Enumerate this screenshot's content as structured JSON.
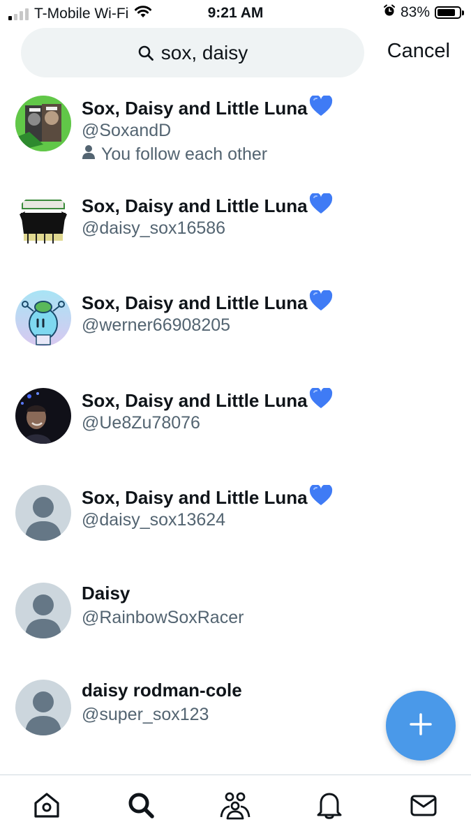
{
  "status_bar": {
    "carrier": "T-Mobile Wi-Fi",
    "time": "9:21 AM",
    "battery_percent": "83%",
    "battery_level": 0.83,
    "signal_bars_active": 1,
    "signal_bars_total": 4,
    "icons": [
      "signal-icon",
      "wifi-icon",
      "alarm-icon",
      "battery-icon"
    ]
  },
  "search": {
    "query": "sox, daisy",
    "cancel_label": "Cancel",
    "icon": "search-icon"
  },
  "results": [
    {
      "name": "Sox, Daisy and Little Luna",
      "handle": "@SoxandD",
      "verified_emoji": "blue-heart",
      "follow_status": "You follow each other",
      "avatar": "photo-cats-green"
    },
    {
      "name": "Sox, Daisy and Little Luna",
      "handle": "@daisy_sox16586",
      "verified_emoji": "blue-heart",
      "avatar": "photo-black-cat-drawing"
    },
    {
      "name": "Sox, Daisy and Little Luna",
      "handle": "@werner66908205",
      "verified_emoji": "blue-heart",
      "avatar": "photo-cartoon-character"
    },
    {
      "name": "Sox, Daisy and Little Luna",
      "handle": "@Ue8Zu78076",
      "verified_emoji": "blue-heart",
      "avatar": "photo-person-night"
    },
    {
      "name": "Sox, Daisy and Little Luna",
      "handle": "@daisy_sox13624",
      "verified_emoji": "blue-heart",
      "avatar": "default-avatar"
    },
    {
      "name": "Daisy",
      "handle": "@RainbowSoxRacer",
      "avatar": "default-avatar"
    },
    {
      "name": "daisy rodman-cole",
      "handle": "@super_sox123",
      "avatar": "default-avatar"
    }
  ],
  "fab": {
    "icon": "plus-icon"
  },
  "tab_bar": {
    "tabs": [
      "home-icon",
      "search-icon",
      "communities-icon",
      "notifications-icon",
      "messages-icon"
    ]
  },
  "colors": {
    "accent": "#4a99e9",
    "secondary_text": "#536471",
    "search_bg": "#eff3f4",
    "heart": "#3f7bf5",
    "default_avatar_bg": "#ccd6dd",
    "default_avatar_fg": "#657786"
  }
}
